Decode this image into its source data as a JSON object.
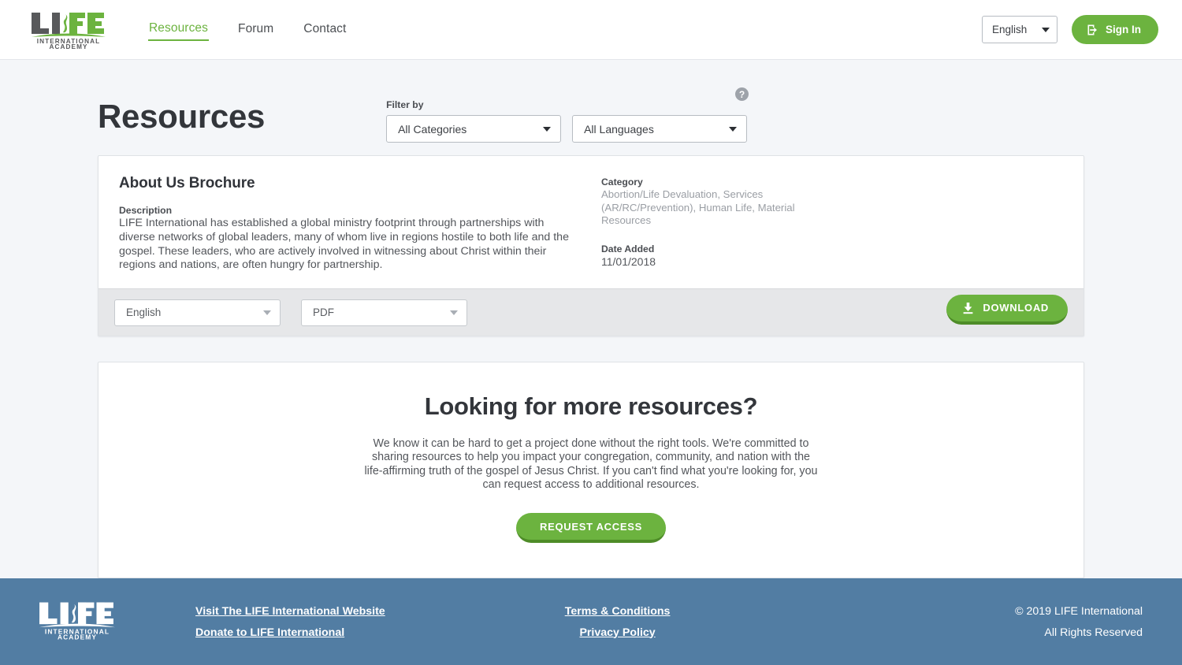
{
  "header": {
    "logo": {
      "wordmark": "LIFE",
      "line1": "INTERNATIONAL",
      "line2": "ACADEMY",
      "name": "life-international-academy-logo"
    },
    "nav": [
      {
        "label": "Resources",
        "active": true
      },
      {
        "label": "Forum",
        "active": false
      },
      {
        "label": "Contact",
        "active": false
      }
    ],
    "language_select": {
      "value": "English",
      "icon": "chevron-down-icon"
    },
    "sign_in": {
      "label": "Sign In",
      "icon": "login-icon"
    }
  },
  "main": {
    "page_title": "Resources",
    "filter": {
      "label": "Filter by",
      "category_select": {
        "value": "All Categories"
      },
      "language_select": {
        "value": "All Languages"
      },
      "help_icon": "?"
    },
    "resource": {
      "title": "About Us Brochure",
      "description_label": "Description",
      "description": "LIFE International has established a global ministry footprint through partnerships with diverse networks of global leaders, many of whom live in regions hostile to both life and the gospel. These leaders, who are actively involved in witnessing about Christ within their regions and nations, are often hungry for partnership.",
      "category_label": "Category",
      "categories": "Abortion/Life Devaluation, Services (AR/RC/Prevention), Human Life, Material Resources",
      "date_label": "Date Added",
      "date_value": "11/01/2018",
      "download_language": "English",
      "download_format": "PDF",
      "download_button": "DOWNLOAD",
      "download_icon": "download-icon"
    },
    "cta": {
      "title": "Looking for more resources?",
      "text": "We know it can be hard to get a project done without the right tools. We're committed to sharing resources to help you impact your congregation, community, and nation with the life-affirming truth of the gospel of Jesus Christ. If you can't find what you're looking for, you can request access to additional resources.",
      "button": "REQUEST ACCESS"
    }
  },
  "footer": {
    "links_left": [
      "Visit The LIFE International Website",
      "Donate to LIFE International"
    ],
    "links_mid": [
      "Terms & Conditions",
      "Privacy Policy"
    ],
    "copyright_line1": "© 2019 LIFE International",
    "copyright_line2": "All Rights Reserved"
  },
  "colors": {
    "brand_green": "#6cb33f",
    "green_shadow": "#4e8c28",
    "footer_blue": "#527da3",
    "page_bg": "#f4f6f9",
    "logo_gray": "#58595b"
  }
}
